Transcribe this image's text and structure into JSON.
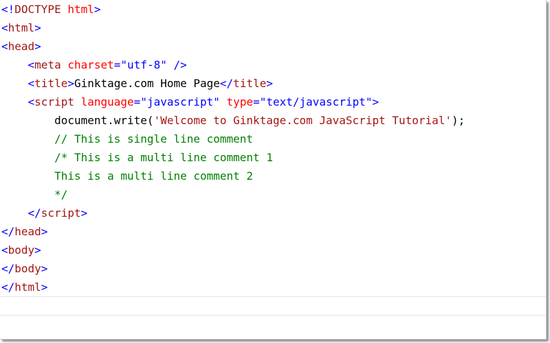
{
  "editor": {
    "lines": [
      [
        {
          "t": "<!",
          "c": "brk"
        },
        {
          "t": "DOCTYPE",
          "c": "tag"
        },
        {
          "t": " ",
          "c": "txt"
        },
        {
          "t": "html",
          "c": "attr"
        },
        {
          "t": ">",
          "c": "brk"
        }
      ],
      [
        {
          "t": "<",
          "c": "brk"
        },
        {
          "t": "html",
          "c": "tag"
        },
        {
          "t": ">",
          "c": "brk"
        }
      ],
      [
        {
          "t": "<",
          "c": "brk"
        },
        {
          "t": "head",
          "c": "tag"
        },
        {
          "t": ">",
          "c": "brk"
        }
      ],
      [
        {
          "t": "    <",
          "c": "brk"
        },
        {
          "t": "meta",
          "c": "tag"
        },
        {
          "t": " ",
          "c": "txt"
        },
        {
          "t": "charset",
          "c": "attr"
        },
        {
          "t": "=",
          "c": "brk"
        },
        {
          "t": "\"utf-8\"",
          "c": "val"
        },
        {
          "t": " />",
          "c": "brk"
        }
      ],
      [
        {
          "t": "    <",
          "c": "brk"
        },
        {
          "t": "title",
          "c": "tag"
        },
        {
          "t": ">",
          "c": "brk"
        },
        {
          "t": "Ginktage.com Home Page",
          "c": "txt"
        },
        {
          "t": "</",
          "c": "brk"
        },
        {
          "t": "title",
          "c": "tag"
        },
        {
          "t": ">",
          "c": "brk"
        }
      ],
      [
        {
          "t": "    <",
          "c": "brk"
        },
        {
          "t": "script",
          "c": "tag"
        },
        {
          "t": " ",
          "c": "txt"
        },
        {
          "t": "language",
          "c": "attr"
        },
        {
          "t": "=",
          "c": "brk"
        },
        {
          "t": "\"javascript\"",
          "c": "val"
        },
        {
          "t": " ",
          "c": "txt"
        },
        {
          "t": "type",
          "c": "attr"
        },
        {
          "t": "=",
          "c": "brk"
        },
        {
          "t": "\"text/javascript\"",
          "c": "val"
        },
        {
          "t": ">",
          "c": "brk"
        }
      ],
      [
        {
          "t": "        document.write(",
          "c": "txt"
        },
        {
          "t": "'Welcome to Ginktage.com JavaScript Tutorial'",
          "c": "str"
        },
        {
          "t": ");",
          "c": "txt"
        }
      ],
      [
        {
          "t": "        // This is single line comment",
          "c": "cmt"
        }
      ],
      [
        {
          "t": "        /* This is a multi line comment 1",
          "c": "cmt"
        }
      ],
      [
        {
          "t": "        This is a multi line comment 2",
          "c": "cmt"
        }
      ],
      [
        {
          "t": "        */",
          "c": "cmt"
        }
      ],
      [
        {
          "t": "    </",
          "c": "brk"
        },
        {
          "t": "script",
          "c": "tag"
        },
        {
          "t": ">",
          "c": "brk"
        }
      ],
      [
        {
          "t": "</",
          "c": "brk"
        },
        {
          "t": "head",
          "c": "tag"
        },
        {
          "t": ">",
          "c": "brk"
        }
      ],
      [
        {
          "t": "<",
          "c": "brk"
        },
        {
          "t": "body",
          "c": "tag"
        },
        {
          "t": ">",
          "c": "brk"
        }
      ],
      [
        {
          "t": "</",
          "c": "brk"
        },
        {
          "t": "body",
          "c": "tag"
        },
        {
          "t": ">",
          "c": "brk"
        }
      ],
      [
        {
          "t": "</",
          "c": "brk"
        },
        {
          "t": "html",
          "c": "tag"
        },
        {
          "t": ">",
          "c": "brk"
        }
      ]
    ]
  },
  "colors": {
    "bracket": "#0000ff",
    "tag": "#a31515",
    "attribute": "#ff0000",
    "attribute_value": "#0000ff",
    "string": "#a31515",
    "comment": "#008000",
    "text": "#000000"
  }
}
